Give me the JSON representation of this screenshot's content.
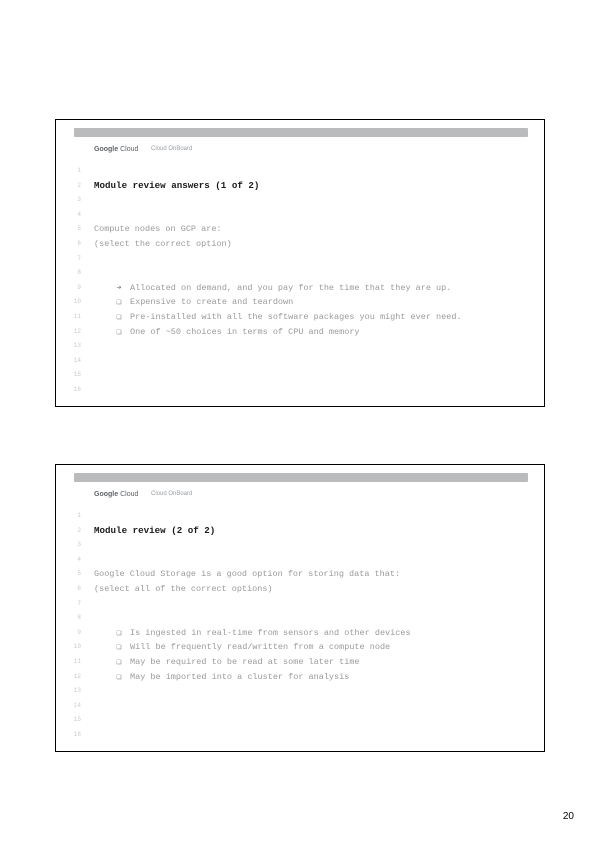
{
  "page_number": "20",
  "brand": {
    "google": "Google",
    "cloud": "Cloud",
    "onboard": "Cloud OnBoard"
  },
  "slide1": {
    "title": "Module review answers (1 of 2)",
    "question": "Compute nodes on GCP are:",
    "instruction": "(select the correct option)",
    "options": [
      {
        "marker": "➔",
        "text": "Allocated on demand, and you pay for the time that they are up."
      },
      {
        "marker": "❏",
        "text": "Expensive to create and teardown"
      },
      {
        "marker": "❏",
        "text": "Pre-installed with all the software packages you might ever need."
      },
      {
        "marker": "❏",
        "text": "One of ~50 choices in terms of CPU and memory"
      }
    ]
  },
  "slide2": {
    "title": "Module review (2 of 2)",
    "question": "Google Cloud Storage is a good option for storing data that:",
    "instruction": "(select all of the correct options)",
    "options": [
      {
        "marker": "❏",
        "text": "Is ingested in real-time from sensors and other devices"
      },
      {
        "marker": "❏",
        "text": "Will be frequently read/written from a compute node"
      },
      {
        "marker": "❏",
        "text": "May be required to be read at some later time"
      },
      {
        "marker": "❏",
        "text": "May be imported into a cluster for analysis"
      }
    ]
  }
}
